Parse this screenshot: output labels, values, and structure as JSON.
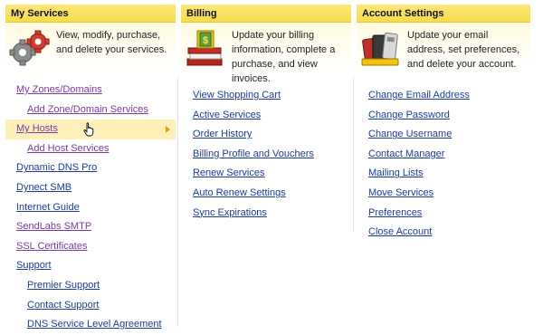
{
  "services": {
    "title": "My Services",
    "description": "View, modify, purchase, and delete your services.",
    "links": [
      {
        "label": "My Zones/Domains",
        "level": 1,
        "visited": true
      },
      {
        "label": "Add Zone/Domain Services",
        "level": 2,
        "visited": true
      },
      {
        "label": "My Hosts",
        "level": 1,
        "visited": true,
        "hovered": true
      },
      {
        "label": "Add Host Services",
        "level": 2,
        "visited": true
      },
      {
        "label": "Dynamic DNS Pro",
        "level": 1
      },
      {
        "label": "Dynect SMB",
        "level": 1
      },
      {
        "label": "Internet Guide",
        "level": 1
      },
      {
        "label": "SendLabs SMTP",
        "level": 1,
        "visited": true
      },
      {
        "label": "SSL Certificates",
        "level": 1,
        "visited": true
      },
      {
        "label": "Support",
        "level": 1
      },
      {
        "label": "Premier Support",
        "level": 2
      },
      {
        "label": "Contact Support",
        "level": 2
      },
      {
        "label": "DNS Service Level Agreement",
        "level": 2
      }
    ]
  },
  "billing": {
    "title": "Billing",
    "description": "Update your billing information, complete a purchase, and view invoices.",
    "links": [
      {
        "label": "View Shopping Cart"
      },
      {
        "label": "Active Services"
      },
      {
        "label": "Order History"
      },
      {
        "label": "Billing Profile and Vouchers"
      },
      {
        "label": "Renew Services"
      },
      {
        "label": "Auto Renew Settings"
      },
      {
        "label": "Sync Expirations"
      }
    ]
  },
  "account": {
    "title": "Account Settings",
    "description": "Update your email address, set preferences, and delete your account.",
    "links": [
      {
        "label": "Change Email Address"
      },
      {
        "label": "Change Password"
      },
      {
        "label": "Change Username"
      },
      {
        "label": "Contact Manager"
      },
      {
        "label": "Mailing Lists"
      },
      {
        "label": "Move Services"
      },
      {
        "label": "Preferences"
      },
      {
        "label": "Close Account"
      }
    ]
  },
  "icons": {
    "services": "gears-icon",
    "billing": "dollar-books-icon",
    "account": "id-cards-icon",
    "cursor": "hand-pointer-icon",
    "submenu": "submenu-arrow-icon"
  },
  "colors": {
    "header": "#f8dc4a",
    "link": "#1a3c9e",
    "visited_link": "#7a3aa8",
    "hover_row": "#fdf1b9",
    "submenu_arrow": "#e0a000"
  }
}
